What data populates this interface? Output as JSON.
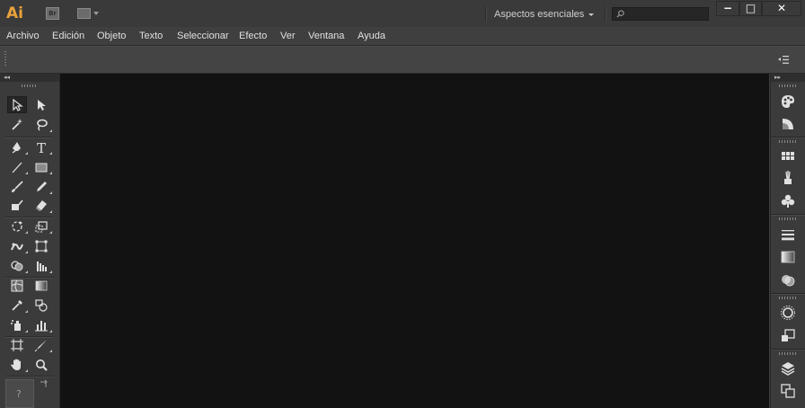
{
  "app": {
    "logo_text": "Ai",
    "bridge_label": "Br"
  },
  "workspace": {
    "label": "Aspectos esenciales"
  },
  "search": {
    "placeholder": ""
  },
  "window_controls": {
    "minimize": "−",
    "maximize": "□",
    "close": "✕"
  },
  "menu": {
    "items": [
      "Archivo",
      "Edición",
      "Objeto",
      "Texto",
      "Seleccionar",
      "Efecto",
      "Ver",
      "Ventana",
      "Ayuda"
    ]
  },
  "toolbox": {
    "collapse_label": "◂◂",
    "fill_stroke_label": "?",
    "tools": [
      {
        "name": "selection-tool-icon",
        "active": true
      },
      {
        "name": "direct-selection-tool-icon"
      },
      {
        "name": "magic-wand-tool-icon"
      },
      {
        "name": "lasso-tool-icon"
      },
      {
        "name": "pen-tool-icon"
      },
      {
        "name": "type-tool-icon",
        "glyph": "T"
      },
      {
        "name": "line-segment-tool-icon"
      },
      {
        "name": "rectangle-tool-icon"
      },
      {
        "name": "paintbrush-tool-icon"
      },
      {
        "name": "pencil-tool-icon"
      },
      {
        "name": "blob-brush-tool-icon"
      },
      {
        "name": "eraser-tool-icon"
      },
      {
        "name": "rotate-tool-icon"
      },
      {
        "name": "scale-tool-icon"
      },
      {
        "name": "width-tool-icon"
      },
      {
        "name": "free-transform-tool-icon"
      },
      {
        "name": "shape-builder-tool-icon"
      },
      {
        "name": "perspective-grid-tool-icon"
      },
      {
        "name": "mesh-tool-icon"
      },
      {
        "name": "gradient-tool-icon"
      },
      {
        "name": "eyedropper-tool-icon"
      },
      {
        "name": "blend-tool-icon"
      },
      {
        "name": "symbol-sprayer-tool-icon"
      },
      {
        "name": "column-graph-tool-icon"
      },
      {
        "name": "artboard-tool-icon"
      },
      {
        "name": "slice-tool-icon"
      },
      {
        "name": "hand-tool-icon"
      },
      {
        "name": "zoom-tool-icon"
      }
    ]
  },
  "dock": {
    "collapse_label": "▸▸",
    "panels": [
      "color-panel-icon",
      "color-guide-panel-icon",
      "swatches-panel-icon",
      "brushes-panel-icon",
      "symbols-panel-icon",
      "stroke-panel-icon",
      "gradient-panel-icon",
      "transparency-panel-icon",
      "appearance-panel-icon",
      "graphic-styles-panel-icon",
      "layers-panel-icon",
      "artboards-panel-icon"
    ]
  },
  "colors": {
    "accent": "#e9a33a",
    "canvas": "#121212",
    "chrome": "#3c3c3c"
  }
}
